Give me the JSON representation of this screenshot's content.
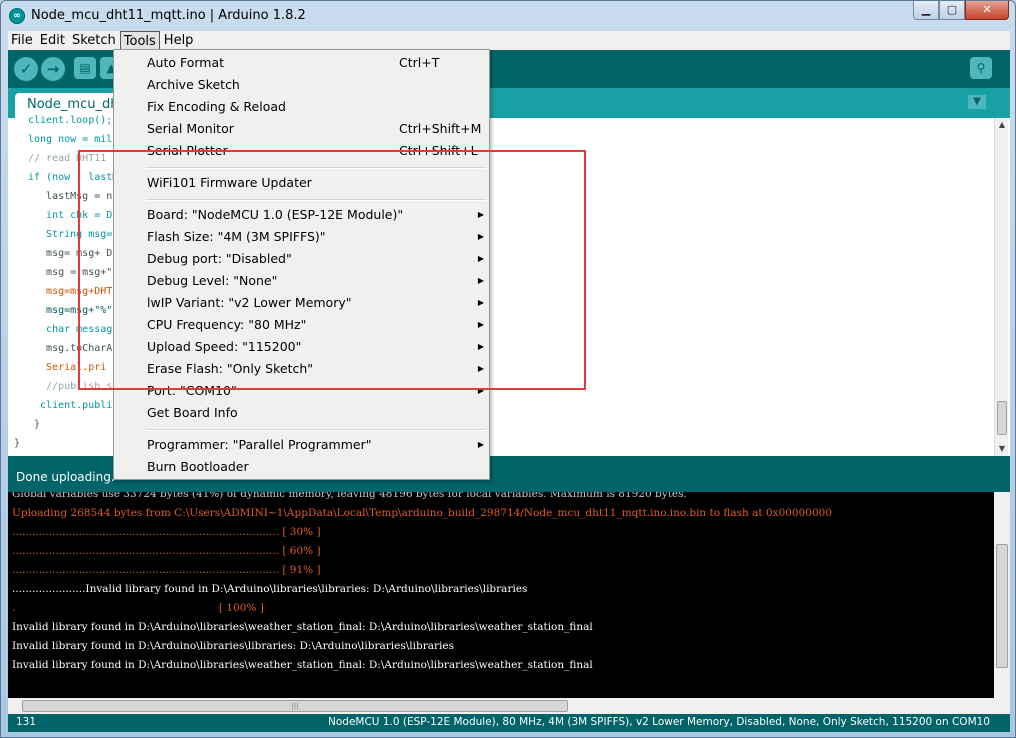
{
  "window": {
    "title": "Node_mcu_dht11_mqtt.ino | Arduino 1.8.2",
    "app_icon": "arduino-logo-icon"
  },
  "menubar": {
    "items": [
      "File",
      "Edit",
      "Sketch",
      "Tools",
      "Help"
    ],
    "open": "Tools"
  },
  "toolbar": {
    "verify_icon": "✓",
    "upload_icon": "→",
    "new_icon": "▤",
    "open_icon": "▲",
    "monitor_icon": "⚲"
  },
  "tab": {
    "name": "Node_mcu_dht11"
  },
  "editor": {
    "lines": [
      "client.loop();",
      "long now = mill",
      "// read DHT11",
      "if (now - lastM",
      "   lastMsg = n",
      "   int chk = D",
      "   String msg=",
      "   msg= msg+ D",
      "   msg = msg+\"",
      "   msg=msg+DHT",
      "   msg=msg+\"%\"",
      "   char messag",
      "   msg.toCharA",
      "   Serial.pri",
      "   //publish s",
      "  client.publi",
      " }",
      "}"
    ]
  },
  "status": {
    "message": "Done uploading."
  },
  "console": {
    "lines": [
      "Global variables use 33724 bytes (41%) of dynamic memory, leaving 48196 bytes for local variables. Maximum is 81920 bytes.",
      "Uploading 268544 bytes from C:\\Users\\ADMINI~1\\AppData\\Local\\Temp\\arduino_build_298714/Node_mcu_dht11_mqtt.ino.ino.bin to flash at 0x00000000",
      "................................................................................ [ 30% ]",
      "................................................................................ [ 60% ]",
      "................................................................................ [ 91% ]",
      "......................Invalid library found in D:\\Arduino\\libraries\\libraries: D:\\Arduino\\libraries\\libraries",
      ".                                                             [ 100% ]",
      "Invalid library found in D:\\Arduino\\libraries\\weather_station_final: D:\\Arduino\\libraries\\weather_station_final",
      "Invalid library found in D:\\Arduino\\libraries\\libraries: D:\\Arduino\\libraries\\libraries",
      "Invalid library found in D:\\Arduino\\libraries\\weather_station_final: D:\\Arduino\\libraries\\weather_station_final"
    ]
  },
  "statusline": {
    "line": "131",
    "board": "NodeMCU 1.0 (ESP-12E Module), 80 MHz, 4M (3M SPIFFS), v2 Lower Memory, Disabled, None, Only Sketch, 115200 on COM10"
  },
  "tools_menu": {
    "auto_format": {
      "label": "Auto Format",
      "shortcut": "Ctrl+T"
    },
    "archive_sketch": {
      "label": "Archive Sketch"
    },
    "fix_encoding": {
      "label": "Fix Encoding & Reload"
    },
    "serial_monitor": {
      "label": "Serial Monitor",
      "shortcut": "Ctrl+Shift+M"
    },
    "serial_plotter": {
      "label": "Serial Plotter",
      "shortcut": "Ctrl+Shift+L"
    },
    "wifi101": {
      "label": "WiFi101 Firmware Updater"
    },
    "board": {
      "label": "Board: \"NodeMCU 1.0 (ESP-12E Module)\""
    },
    "flash_size": {
      "label": "Flash Size: \"4M (3M SPIFFS)\""
    },
    "debug_port": {
      "label": "Debug port: \"Disabled\""
    },
    "debug_level": {
      "label": "Debug Level: \"None\""
    },
    "lwip": {
      "label": "lwIP Variant: \"v2 Lower Memory\""
    },
    "cpu_freq": {
      "label": "CPU Frequency: \"80 MHz\""
    },
    "upload_speed": {
      "label": "Upload Speed: \"115200\""
    },
    "erase_flash": {
      "label": "Erase Flash: \"Only Sketch\""
    },
    "port": {
      "label": "Port: \"COM10\""
    },
    "get_board_info": {
      "label": "Get Board Info"
    },
    "programmer": {
      "label": "Programmer: \"Parallel Programmer\""
    },
    "burn_bootloader": {
      "label": "Burn Bootloader"
    },
    "submenu_arrow": "▶"
  },
  "colors": {
    "teal_dark": "#006468",
    "teal_mid": "#17a1a5",
    "highlight_red": "#e03a3a",
    "console_orange": "#e05c27"
  }
}
